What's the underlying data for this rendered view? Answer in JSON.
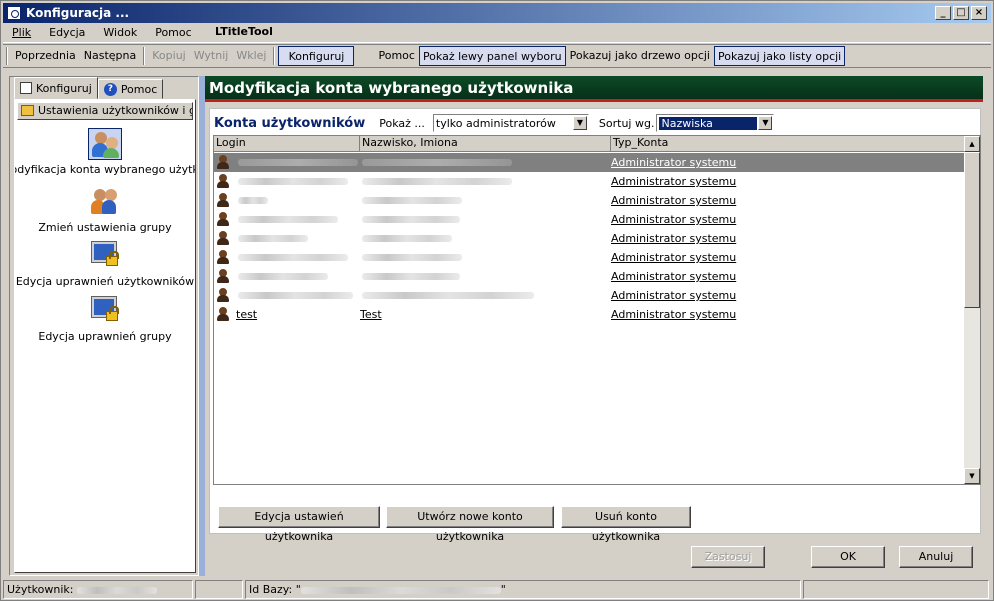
{
  "window": {
    "title": "Konfiguracja ...",
    "min": "_",
    "max": "□",
    "close": "×"
  },
  "menu": [
    "Plik",
    "Edycja",
    "Widok",
    "Pomoc"
  ],
  "ltitle": "LTitleTool",
  "toolbar": {
    "prev": "Poprzednia",
    "next": "Następna",
    "copy": "Kopiuj",
    "cut": "Wytnij",
    "paste": "Wklej",
    "configure": "Konfiguruj",
    "help": "Pomoc",
    "show_left": "Pokaż lewy panel wyboru",
    "as_tree": "Pokazuj jako drzewo opcji",
    "as_list": "Pokazuj jako listy opcji"
  },
  "left": {
    "tab_configure": "Konfiguruj",
    "tab_help": "Pomoc",
    "group": "Ustawienia użytkowników i g...",
    "items": [
      {
        "label": "Modyfikacja konta wybranego użytkownika",
        "icon": "users-edit-icon"
      },
      {
        "label": "Zmień ustawienia grupy",
        "icon": "group-icon"
      },
      {
        "label": "Edycja uprawnień użytkowników",
        "icon": "monitor-lock-icon"
      },
      {
        "label": "Edycja uprawnień grupy",
        "icon": "monitor-lock-icon"
      }
    ]
  },
  "main": {
    "banner": "Modyfikacja konta wybranego użytkownika",
    "list_title": "Konta użytkowników",
    "show_label": "Pokaż ...",
    "show_value": "tylko administratorów",
    "sort_label": "Sortuj wg.",
    "sort_value": "Nazwiska",
    "columns": [
      "Login",
      "Nazwisko, Imiona",
      "Typ_Konta"
    ],
    "rows": [
      {
        "login": "",
        "name": "",
        "type": "Administrator systemu",
        "lw": 120,
        "nw": 150
      },
      {
        "login": "",
        "name": "",
        "type": "Administrator systemu",
        "lw": 110,
        "nw": 150
      },
      {
        "login": "",
        "name": "",
        "type": "Administrator systemu",
        "lw": 30,
        "nw": 100
      },
      {
        "login": "",
        "name": "",
        "type": "Administrator systemu",
        "lw": 100,
        "nw": 98
      },
      {
        "login": "",
        "name": "",
        "type": "Administrator systemu",
        "lw": 70,
        "nw": 90
      },
      {
        "login": "",
        "name": "",
        "type": "Administrator systemu",
        "lw": 110,
        "nw": 100
      },
      {
        "login": "",
        "name": "",
        "type": "Administrator systemu",
        "lw": 90,
        "nw": 98
      },
      {
        "login": "",
        "name": "",
        "type": "Administrator systemu",
        "lw": 115,
        "nw": 172
      },
      {
        "login": "test",
        "name": "Test",
        "type": "Administrator systemu",
        "lw": 0,
        "nw": 0
      }
    ],
    "btn_edit": "Edycja ustawień użytkownika",
    "btn_new": "Utwórz nowe konto użytkownika",
    "btn_delete": "Usuń konto użytkownika",
    "btn_apply": "Zastosuj",
    "btn_ok": "OK",
    "btn_cancel": "Anuluj"
  },
  "status": {
    "user_label": "Użytkownik:",
    "db_label": "Id Bazy: \"",
    "db_end": "\""
  }
}
